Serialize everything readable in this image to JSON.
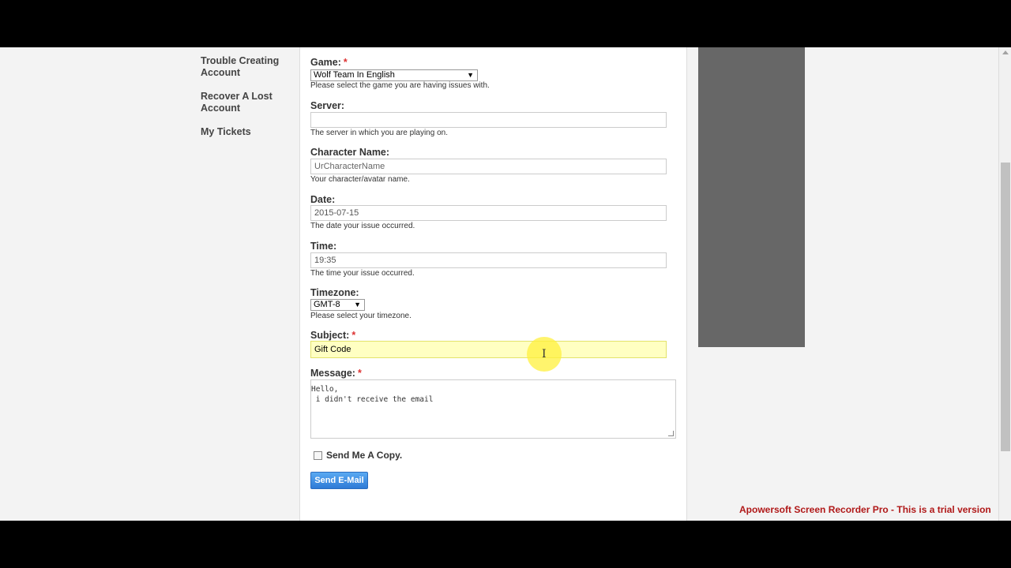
{
  "sidebar": {
    "items": [
      {
        "label": "Trouble Creating Account"
      },
      {
        "label": "Recover A Lost Account"
      },
      {
        "label": "My Tickets"
      }
    ]
  },
  "form": {
    "game": {
      "label": "Game:",
      "required": "*",
      "value": "Wolf Team In English",
      "help": "Please select the game you are having issues with."
    },
    "server": {
      "label": "Server:",
      "value": "",
      "help": "The server in which you are playing on."
    },
    "character": {
      "label": "Character Name:",
      "placeholder": "UrCharacterName",
      "help": "Your character/avatar name."
    },
    "date": {
      "label": "Date:",
      "value": "2015-07-15",
      "help": "The date your issue occurred."
    },
    "time": {
      "label": "Time:",
      "value": "19:35",
      "help": "The time your issue occurred."
    },
    "timezone": {
      "label": "Timezone:",
      "value": "GMT-8",
      "help": "Please select your timezone."
    },
    "subject": {
      "label": "Subject:",
      "required": "*",
      "value": "Gift Code"
    },
    "message": {
      "label": "Message:",
      "required": "*",
      "value": "Hello,\n i didn't receive the email"
    },
    "copy": {
      "label": "Send Me A Copy."
    },
    "submit": {
      "label": "Send E-Mail"
    }
  },
  "watermark": "Apowersoft Screen Recorder Pro - This is a trial version",
  "colors": {
    "accent": "#2e7bd6",
    "highlight": "#ffffc2",
    "required": "#dd3333",
    "watermark": "#b01818"
  }
}
